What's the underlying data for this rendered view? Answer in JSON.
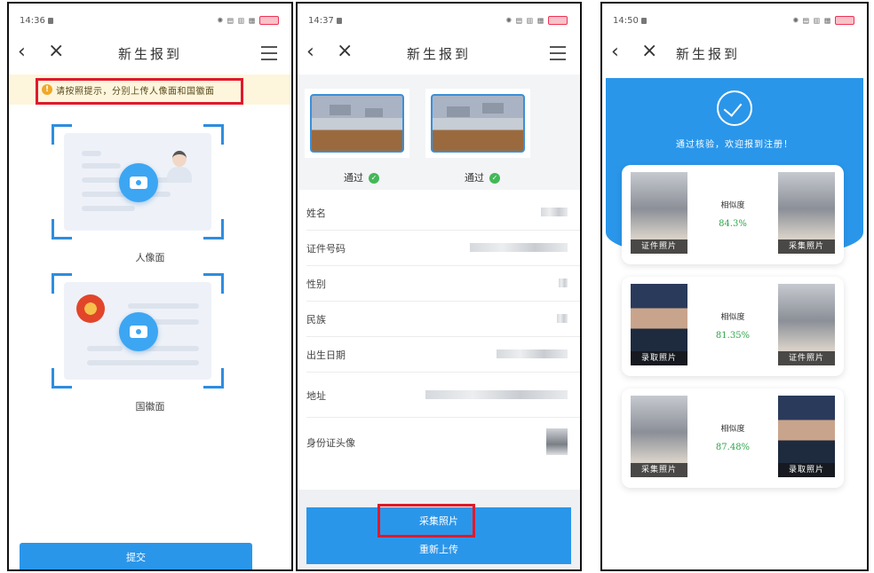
{
  "colors": {
    "primary": "#2a96ea",
    "highlight": "#e0192b",
    "success": "#43b857",
    "notice_bg": "#fdf6dd"
  },
  "panel1": {
    "status": {
      "time": "14:36"
    },
    "nav": {
      "title": "新生报到"
    },
    "notice": "请按照提示，分别上传人像面和国徽面",
    "portrait_caption": "人像面",
    "emblem_caption": "国徽面",
    "submit_label": "提交"
  },
  "panel2": {
    "status": {
      "time": "14:37"
    },
    "nav": {
      "title": "新生报到"
    },
    "pass_left": "通过",
    "pass_right": "通过",
    "fields": [
      {
        "label": "姓名"
      },
      {
        "label": "证件号码"
      },
      {
        "label": "性别"
      },
      {
        "label": "民族"
      },
      {
        "label": "出生日期"
      },
      {
        "label": "地址"
      },
      {
        "label": "身份证头像"
      }
    ],
    "collect_label": "采集照片",
    "reupload_label": "重新上传"
  },
  "panel3": {
    "status": {
      "time": "14:50"
    },
    "nav": {
      "title": "新生报到"
    },
    "verified_text": "通过核验，欢迎报到注册！",
    "comparisons": [
      {
        "left_tag": "证件照片",
        "similarity_label": "相似度",
        "similarity": "84.3%",
        "right_tag": "采集照片"
      },
      {
        "left_tag": "录取照片",
        "similarity_label": "相似度",
        "similarity": "81.35%",
        "right_tag": "证件照片"
      },
      {
        "left_tag": "采集照片",
        "similarity_label": "相似度",
        "similarity": "87.48%",
        "right_tag": "录取照片"
      }
    ]
  }
}
